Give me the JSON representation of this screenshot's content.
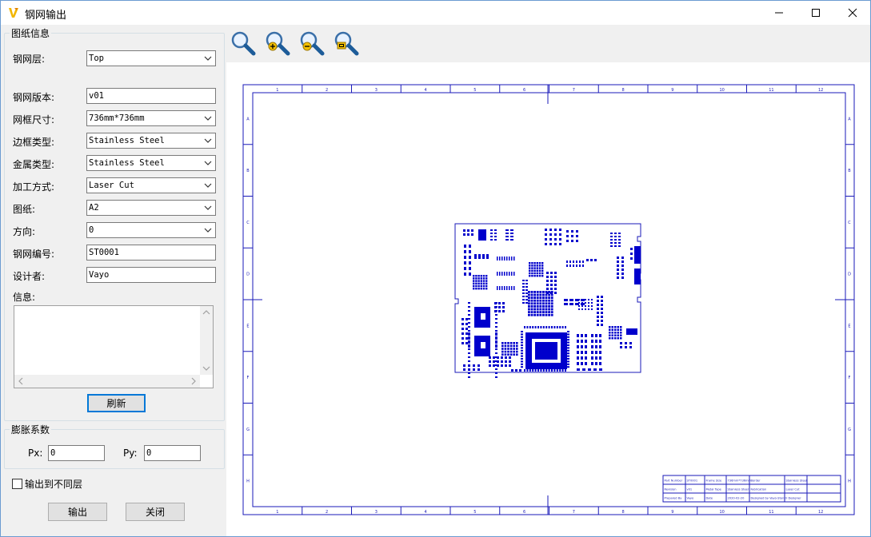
{
  "window": {
    "title": "钢网输出"
  },
  "drawing_info": {
    "group_title": "图纸信息",
    "fields": [
      {
        "label": "钢网层:",
        "type": "combo",
        "value": "Top"
      },
      {
        "label": "钢网版本:",
        "type": "text",
        "value": "v01"
      },
      {
        "label": "网框尺寸:",
        "type": "combo",
        "value": "736mm*736mm"
      },
      {
        "label": "边框类型:",
        "type": "combo",
        "value": "Stainless Steel"
      },
      {
        "label": "金属类型:",
        "type": "combo",
        "value": "Stainless Steel"
      },
      {
        "label": "加工方式:",
        "type": "combo",
        "value": "Laser Cut"
      },
      {
        "label": "图纸:",
        "type": "combo",
        "value": "A2"
      },
      {
        "label": "方向:",
        "type": "combo",
        "value": "0"
      },
      {
        "label": "钢网编号:",
        "type": "text",
        "value": "ST0001"
      },
      {
        "label": "设计者:",
        "type": "text",
        "value": "Vayo"
      }
    ],
    "info_label": "信息:",
    "info_value": "",
    "refresh_button": "刷新"
  },
  "expansion": {
    "group_title": "膨胀系数",
    "px_label": "Px:",
    "px_value": "0",
    "py_label": "Py:",
    "py_value": "0"
  },
  "options": {
    "output_diff_layer_label": "输出到不同层",
    "output_diff_layer_checked": false
  },
  "actions": {
    "output_button": "输出",
    "close_button": "关闭"
  },
  "toolbar": {
    "icons": [
      "zoom-icon",
      "zoom-in-icon",
      "zoom-out-icon",
      "zoom-fit-icon"
    ]
  },
  "drawing": {
    "border_top_numbers": [
      "1",
      "2",
      "3",
      "4",
      "5",
      "6",
      "7",
      "8",
      "9",
      "10",
      "11",
      "12"
    ],
    "border_side_letters": [
      "A",
      "B",
      "C",
      "D",
      "E",
      "F",
      "G",
      "H"
    ],
    "title_block": [
      [
        "Part Number",
        "ST0001",
        "Frame Size",
        "736mm*736mm",
        "Border",
        "Stainless Steel"
      ],
      [
        "Revision",
        "v01",
        "Metal Type",
        "Stainless Steel",
        "Fabrication",
        "Laser Cut"
      ],
      [
        "Prepared By",
        "Vayo",
        "Date",
        "2020-02-20",
        "Designed by Vayo-Stencil Designer",
        ""
      ]
    ]
  },
  "colors": {
    "pad_blue": "#0000cc",
    "line_blue": "#1a1ab8",
    "focus_blue": "#0078d7"
  }
}
